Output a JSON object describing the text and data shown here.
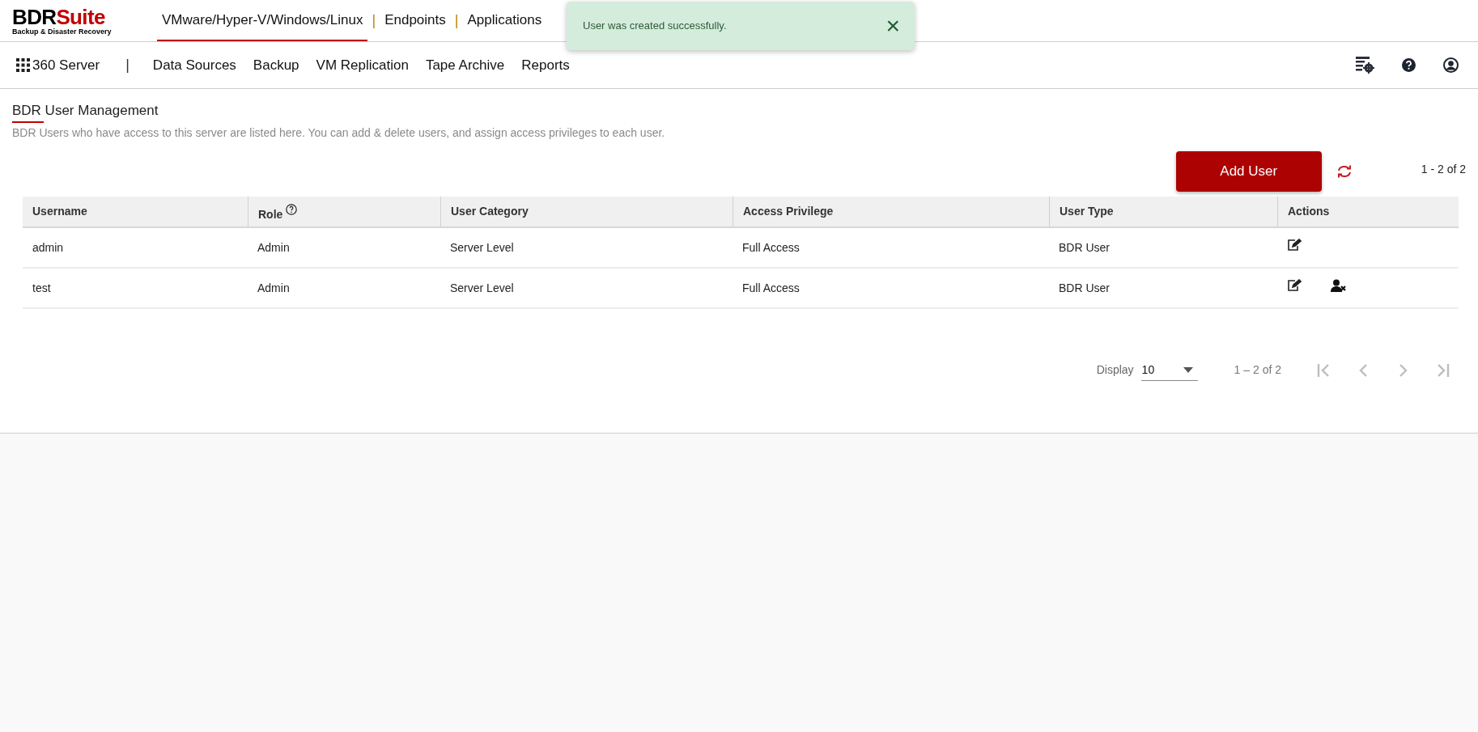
{
  "logo": {
    "brand_dark": "BDR",
    "brand_accent": "Suite",
    "tagline": "Backup & Disaster Recovery"
  },
  "product_tabs": {
    "separator": "|",
    "items": [
      {
        "label": "VMware/Hyper-V/Windows/Linux",
        "selected": true
      },
      {
        "label": "Endpoints",
        "selected": false
      },
      {
        "label": "Applications",
        "selected": false
      }
    ]
  },
  "toast": {
    "message": "User was created successfully.",
    "close": "×"
  },
  "sub_nav": {
    "home": "360 Server",
    "separator": "|",
    "items": [
      {
        "label": "Data Sources"
      },
      {
        "label": "Backup"
      },
      {
        "label": "VM Replication"
      },
      {
        "label": "Tape Archive"
      },
      {
        "label": "Reports"
      }
    ]
  },
  "page": {
    "title": "BDR User Management",
    "description": "BDR Users who have access to this server are listed here. You can add & delete users, and assign access privileges to each user."
  },
  "toolbar": {
    "add_button": "Add User",
    "count": "1 - 2 of 2"
  },
  "table": {
    "columns": [
      {
        "label": "Username",
        "help": false
      },
      {
        "label": "Role",
        "help": true
      },
      {
        "label": "User Category",
        "help": false
      },
      {
        "label": "Access Privilege",
        "help": false
      },
      {
        "label": "User Type",
        "help": false
      },
      {
        "label": "Actions",
        "help": false
      }
    ],
    "rows": [
      {
        "cells": [
          "admin",
          "Admin",
          "Server Level",
          "Full Access",
          "BDR User"
        ],
        "can_edit": true,
        "can_delete": false
      },
      {
        "cells": [
          "test",
          "Admin",
          "Server Level",
          "Full Access",
          "BDR User"
        ],
        "can_edit": true,
        "can_delete": true
      }
    ]
  },
  "pagination": {
    "display_label": "Display",
    "page_size": "10",
    "range": "1 – 2 of 2"
  }
}
